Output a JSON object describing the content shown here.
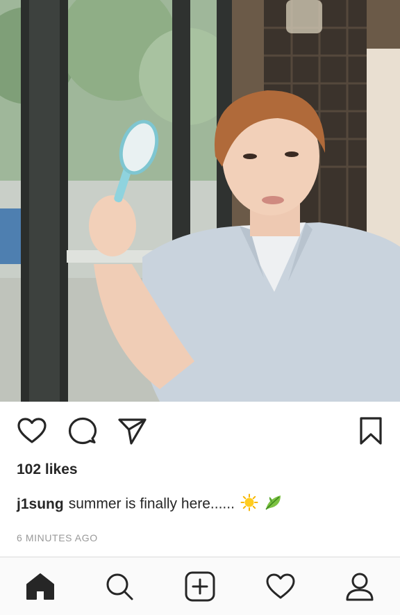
{
  "post": {
    "likes_text": "102 likes",
    "username": "j1sung",
    "caption_text": "summer is finally here......",
    "caption_emojis": [
      "sun-emoji",
      "leaf-emoji"
    ],
    "timestamp": "6 MINUTES AGO"
  },
  "actions": {
    "like_icon": "heart-outline-icon",
    "comment_icon": "comment-bubble-icon",
    "share_icon": "paper-plane-icon",
    "save_icon": "bookmark-icon"
  },
  "tabbar": {
    "items": [
      "home-icon",
      "search-icon",
      "add-post-icon",
      "activity-heart-icon",
      "profile-icon"
    ],
    "active": "home-icon"
  },
  "colors": {
    "text": "#262626",
    "muted": "#999999",
    "divider": "#dbdbdb",
    "tabbar_bg": "#fafafa"
  }
}
